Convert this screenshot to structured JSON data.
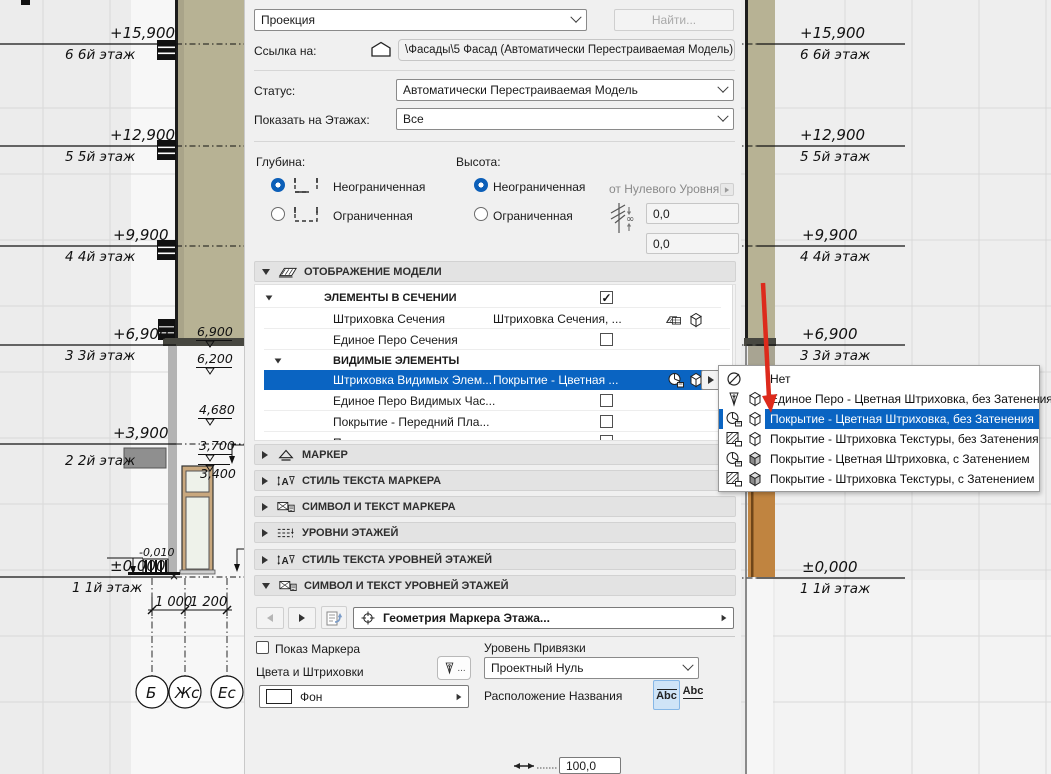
{
  "colors": {
    "selection_blue": "#0a64c2",
    "facade_olive": "#b7b294",
    "wood_orange": "#c08440",
    "annotation_red": "#dd2a1c",
    "panel_gray": "#f0f0f0"
  },
  "drawing": {
    "levels": [
      {
        "elev": "+15,900",
        "floor": "6 6й этаж"
      },
      {
        "elev": "+12,900",
        "floor": "5 5й этаж"
      },
      {
        "elev": "+9,900",
        "floor": "4 4й этаж"
      },
      {
        "elev": "+6,900",
        "floor": "3 3й этаж"
      },
      {
        "elev": "+3,900",
        "floor": "2 2й этаж"
      },
      {
        "elev": "±0,000",
        "floor": "1 1й этаж"
      }
    ],
    "spot_levels": [
      "6,900",
      "6,200",
      "4,680",
      "3,700",
      "3,400"
    ],
    "below_zero": "-0,010",
    "dims": [
      "1 000",
      "1 200"
    ],
    "axes": [
      "Б",
      "Жс",
      "Ес"
    ]
  },
  "dialog": {
    "type_value": "Проекция",
    "find": "Найти...",
    "link": {
      "label": "Ссылка на:",
      "value": "\\Фасады\\5 Фасад (Автоматически Перестраиваемая Модель)"
    },
    "status": {
      "label": "Статус:",
      "value": "Автоматически Перестраиваемая Модель"
    },
    "floors": {
      "label": "Показать на Этажах:",
      "value": "Все"
    },
    "depth": {
      "label": "Глубина:",
      "unlimited": "Неограниченная",
      "limited": "Ограниченная"
    },
    "height": {
      "label": "Высота:",
      "unlimited": "Неограниченная",
      "limited": "Ограниченная",
      "from_zero": "от Нулевого Уровня",
      "offset_top": "0,0",
      "offset_bottom": "0,0"
    },
    "sections": {
      "model_display": "ОТОБРАЖЕНИЕ МОДЕЛИ",
      "cut": {
        "title": "ЭЛЕМЕНТЫ В СЕЧЕНИИ",
        "row1": {
          "name": "Штриховка Сечения",
          "value": "Штриховка Сечения, ..."
        },
        "row2": {
          "name": "Единое Перо Сечения"
        }
      },
      "visible": {
        "title": "ВИДИМЫЕ ЭЛЕМЕНТЫ",
        "row1": {
          "name": "Штриховка Видимых Элем...",
          "value": "Покрытие - Цветная ..."
        },
        "row2": {
          "name": "Единое Перо Видимых Час..."
        },
        "row3": {
          "name": "Покрытие - Передний Пла..."
        },
        "row4": {
          "name": "Прозрачность"
        }
      },
      "marker": "МАРКЕР",
      "marker_text_style": "СТИЛЬ ТЕКСТА МАРКЕРА",
      "marker_symbol_text": "СИМВОЛ И ТЕКСТ МАРКЕРА",
      "story_levels": "УРОВНИ ЭТАЖЕЙ",
      "story_text_style": "СТИЛЬ ТЕКСТА УРОВНЕЙ ЭТАЖЕЙ",
      "story_symbol_text": "СИМВОЛ И ТЕКСТ УРОВНЕЙ ЭТАЖЕЙ"
    },
    "nav_combo": "Геометрия Маркера Этажа...",
    "bottom": {
      "show_marker": "Показ Маркера",
      "colors_hatching": "Цвета и Штриховки",
      "background": "Фон",
      "anchor_label": "Уровень Привязки",
      "anchor_value": "Проектный Нуль",
      "name_position": "Расположение Названия",
      "abc": "Abc",
      "size_value": "100,0",
      "dots": "..."
    }
  },
  "menu": {
    "items": [
      {
        "label": "Нет"
      },
      {
        "label": "Единое Перо - Цветная Штриховка, без Затенения"
      },
      {
        "label": "Покрытие - Цветная Штриховка, без Затенения"
      },
      {
        "label": "Покрытие - Штриховка Текстуры, без Затенения"
      },
      {
        "label": "Покрытие - Цветная Штриховка, с Затенением"
      },
      {
        "label": "Покрытие - Штриховка Текстуры, с Затенением"
      }
    ],
    "selected_index": 2
  }
}
